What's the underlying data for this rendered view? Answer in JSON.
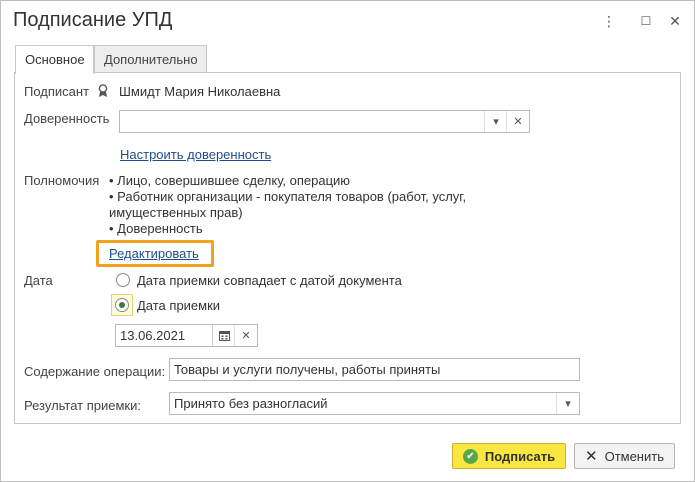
{
  "window": {
    "title": "Подписание УПД",
    "controls": {
      "more": "⋮",
      "maximize": "☐",
      "close": "✕"
    }
  },
  "tabs": [
    {
      "label": "Основное",
      "active": true
    },
    {
      "label": "Дополнительно",
      "active": false
    }
  ],
  "form": {
    "signer_label": "Подписант",
    "signer_value": "Шмидт Мария Николаевна",
    "signer_icon": "person-stamp-icon",
    "poa_label": "Доверенность",
    "poa_value": "",
    "configure_poa_link": "Настроить доверенность",
    "powers_label": "Полномочия",
    "powers_lines": [
      "• Лицо, совершившее сделку, операцию",
      "• Работник организации - покупателя товаров (работ, услуг,",
      "имущественных прав)",
      "• Доверенность"
    ],
    "edit_link": "Редактировать",
    "date_label": "Дата",
    "date_option_1": "Дата приемки совпадает с датой документа",
    "date_option_2": "Дата приемки",
    "selected_date_option": 2,
    "date_value": "13.06.2021",
    "operation_label": "Содержание операции:",
    "operation_value": "Товары и услуги получены, работы приняты",
    "result_label": "Результат приемки:",
    "result_value": "Принято без разногласий"
  },
  "buttons": {
    "sign": "Подписать",
    "cancel": "Отменить"
  },
  "colors": {
    "primary_button": "#f9e640",
    "link": "#1c4e8c",
    "highlight": "#f2a21c"
  }
}
